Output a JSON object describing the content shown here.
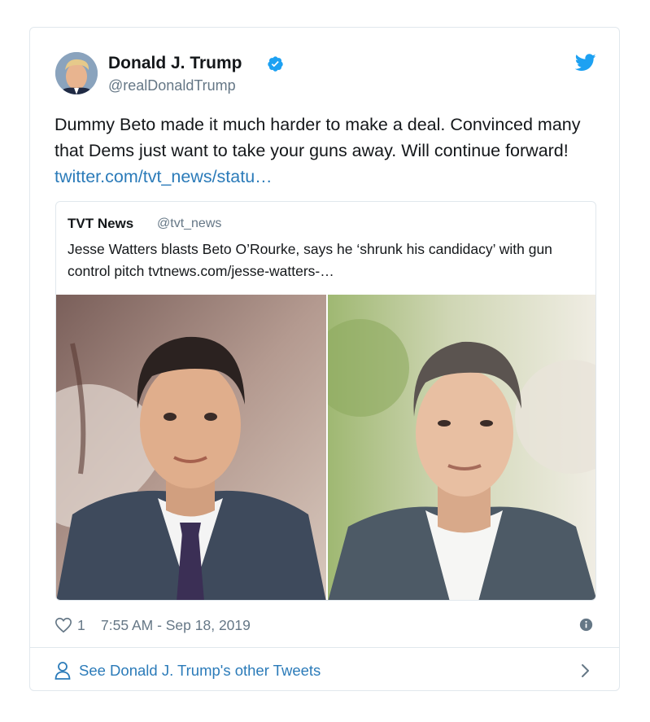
{
  "tweet": {
    "author_name": "Donald J. Trump",
    "author_handle": "@realDonaldTrump",
    "text": "Dummy Beto made it much harder to make a deal. Convinced many that Dems just want to take your guns away. Will continue forward!",
    "link": "twitter.com/tvt_news/statu…",
    "likes": "1",
    "timestamp": "7:55 AM - Sep 18, 2019"
  },
  "quote": {
    "author_name": "TVT News",
    "author_handle": "@tvt_news",
    "text": "Jesse Watters blasts Beto O’Rourke, says he ‘shrunk his candidacy’ with gun control pitch",
    "link": "tvtnews.com/jesse-watters-…"
  },
  "footer": {
    "label": "See Donald J. Trump's other Tweets"
  },
  "icons": {
    "verified": "verified-badge-icon",
    "brand": "twitter-bird-icon",
    "like": "heart-icon",
    "info": "info-icon",
    "profile": "person-icon",
    "more": "chevron-right-icon"
  },
  "colors": {
    "link": "#2b7bb9",
    "verified": "#1da1f2",
    "secondary_text": "#657786",
    "border": "#e1e8ed"
  }
}
